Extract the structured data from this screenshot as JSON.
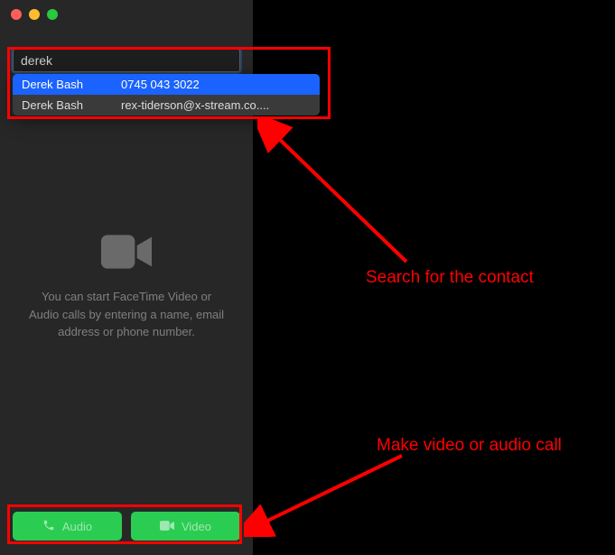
{
  "search": {
    "value": "derek"
  },
  "results": [
    {
      "name": "Derek Bash",
      "detail": "0745 043 3022",
      "selected": true
    },
    {
      "name": "Derek Bash",
      "detail": "rex-tiderson@x-stream.co....",
      "selected": false
    }
  ],
  "placeholder": {
    "text": "You can start FaceTime Video or Audio calls by entering a name, email address or phone number."
  },
  "buttons": {
    "audio": "Audio",
    "video": "Video"
  },
  "annotations": {
    "search_label": "Search for the contact",
    "call_label": "Make video or audio call"
  }
}
